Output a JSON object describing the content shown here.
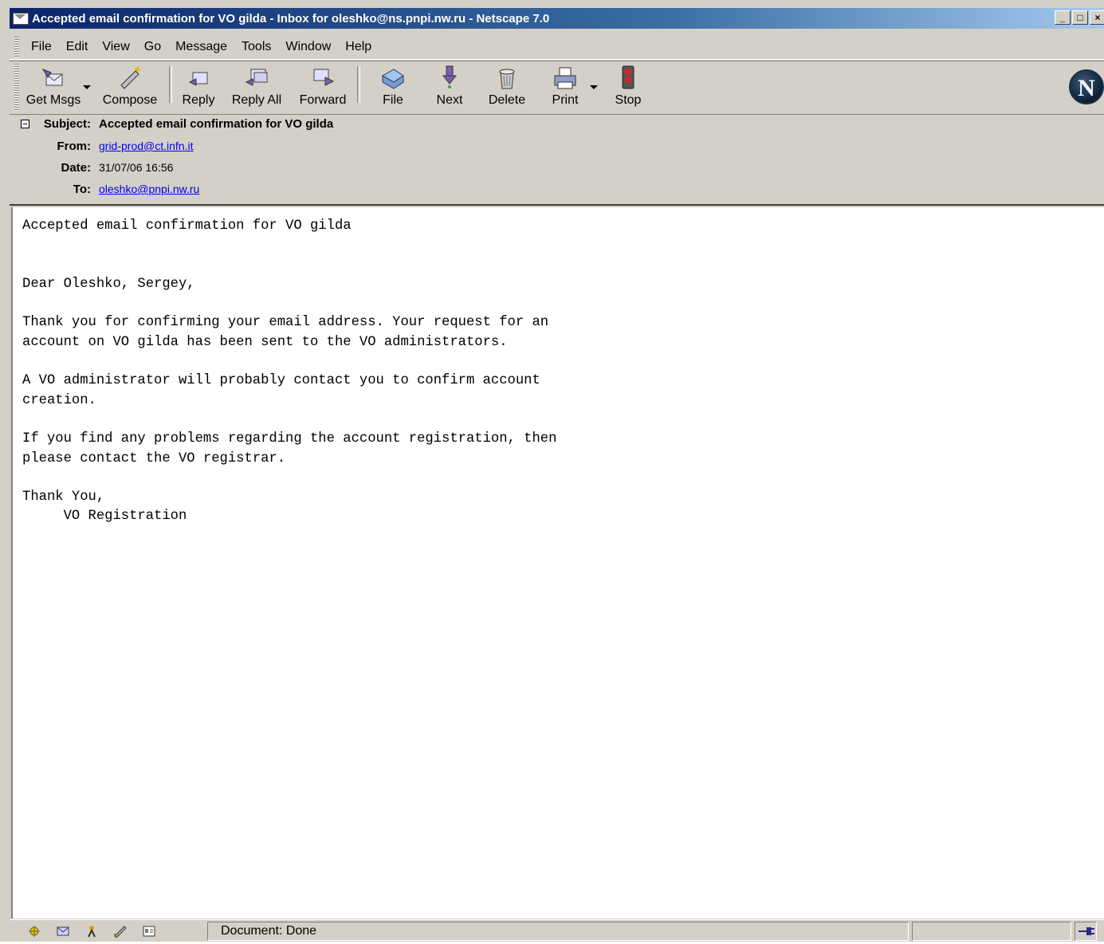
{
  "window": {
    "title": "Accepted email confirmation for VO gilda - Inbox for oleshko@ns.pnpi.nw.ru - Netscape 7.0",
    "minimize_label": "_",
    "maximize_label": "□",
    "close_label": "×"
  },
  "menubar": {
    "items": [
      {
        "label": "File"
      },
      {
        "label": "Edit"
      },
      {
        "label": "View"
      },
      {
        "label": "Go"
      },
      {
        "label": "Message"
      },
      {
        "label": "Tools"
      },
      {
        "label": "Window"
      },
      {
        "label": "Help"
      }
    ]
  },
  "toolbar": {
    "get_msgs": "Get Msgs",
    "compose": "Compose",
    "reply": "Reply",
    "reply_all": "Reply All",
    "forward": "Forward",
    "file": "File",
    "next": "Next",
    "delete": "Delete",
    "print": "Print",
    "stop": "Stop",
    "logo": "N"
  },
  "header": {
    "subject_label": "Subject:",
    "subject": "Accepted email confirmation for VO gilda",
    "from_label": "From:",
    "from": "grid-prod@ct.infn.it",
    "date_label": "Date:",
    "date": "31/07/06 16:56",
    "to_label": "To:",
    "to": "oleshko@pnpi.nw.ru"
  },
  "body": {
    "lines": [
      "Accepted email confirmation for VO gilda",
      "",
      "",
      "Dear Oleshko, Sergey,",
      "",
      "Thank you for confirming your email address. Your request for an",
      "account on VO gilda has been sent to the VO administrators.",
      "",
      "A VO administrator will probably contact you to confirm account",
      "creation.",
      "",
      "If you find any problems regarding the account registration, then",
      "please contact the VO registrar.",
      "",
      "Thank You,",
      "     VO Registration"
    ]
  },
  "status": {
    "text": "Document: Done"
  }
}
